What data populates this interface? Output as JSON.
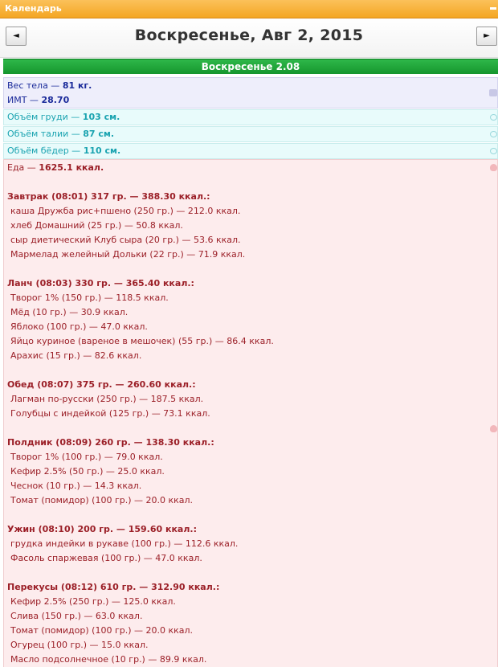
{
  "window": {
    "title": "Календарь"
  },
  "nav": {
    "prev_glyph": "◄",
    "next_glyph": "►",
    "date": "Воскресенье, Авг 2, 2015"
  },
  "day_header": "Воскресенье 2.08",
  "weight": {
    "weight_label": "Вес тела — ",
    "weight_value": "81 кг.",
    "bmi_label": "ИМТ — ",
    "bmi_value": "28.70",
    "icon": "scale-icon"
  },
  "measurements": [
    {
      "label": "Объём груди — ",
      "value": "103 см."
    },
    {
      "label": "Объём талии — ",
      "value": "87 см."
    },
    {
      "label": "Объём бёдер — ",
      "value": "110 см."
    }
  ],
  "food": {
    "total_label": "Еда — ",
    "total_value": "1625.1 ккал.",
    "meals": [
      {
        "title": "Завтрак (08:01) 317 гр. — 388.30 ккал.:",
        "items": [
          "каша Дружба рис+пшено (250 гр.) — 212.0 ккал.",
          "хлеб Домашний (25 гр.) — 50.8 ккал.",
          "сыр диетический Клуб сыра (20 гр.) — 53.6 ккал.",
          "Мармелад желейный Дольки (22 гр.) — 71.9 ккал."
        ]
      },
      {
        "title": "Ланч (08:03) 330 гр. — 365.40 ккал.:",
        "items": [
          "Творог 1% (150 гр.) — 118.5 ккал.",
          "Мёд (10 гр.) — 30.9 ккал.",
          "Яблоко (100 гр.) — 47.0 ккал.",
          "Яйцо куриное (вареное в мешочек) (55 гр.) — 86.4 ккал.",
          "Арахис (15 гр.) — 82.6 ккал."
        ]
      },
      {
        "title": "Обед (08:07) 375 гр. — 260.60 ккал.:",
        "items": [
          "Лагман по-русски (250 гр.) — 187.5 ккал.",
          "Голубцы с индейкой (125 гр.) — 73.1 ккал."
        ]
      },
      {
        "title": "Полдник (08:09) 260 гр. — 138.30 ккал.:",
        "items": [
          "Творог 1% (100 гр.) — 79.0 ккал.",
          "Кефир 2.5% (50 гр.) — 25.0 ккал.",
          "Чеснок (10 гр.) — 14.3 ккал.",
          "Томат (помидор) (100 гр.) — 20.0 ккал."
        ]
      },
      {
        "title": "Ужин (08:10) 200 гр. — 159.60 ккал.:",
        "items": [
          "грудка индейки в рукаве (100 гр.) — 112.6 ккал.",
          "Фасоль спаржевая (100 гр.) — 47.0 ккал."
        ]
      },
      {
        "title": "Перекусы (08:12) 610 гр. — 312.90 ккал.:",
        "items": [
          "Кефир 2.5% (250 гр.) — 125.0 ккал.",
          "Слива (150 гр.) — 63.0 ккал.",
          "Томат (помидор) (100 гр.) — 20.0 ккал.",
          "Огурец (100 гр.) — 15.0 ккал.",
          "Масло подсолнечное (10 гр.) — 89.9 ккал."
        ]
      }
    ]
  }
}
